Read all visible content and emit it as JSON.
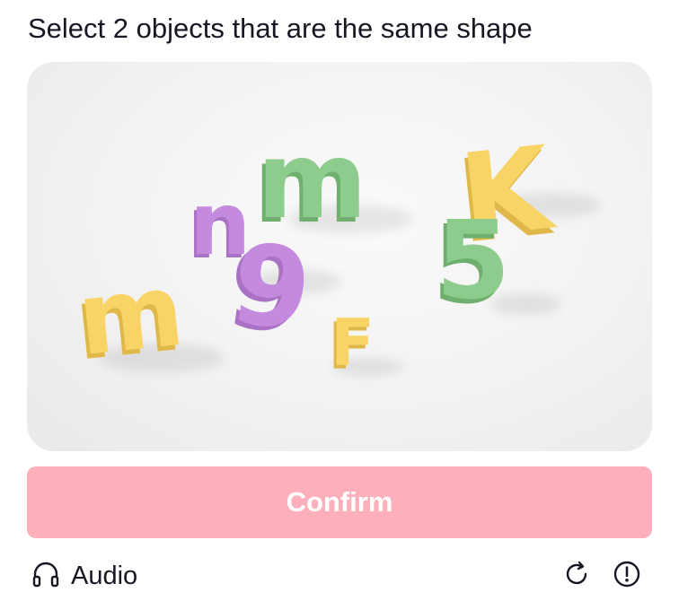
{
  "prompt": "Select 2 objects that are the same shape",
  "puzzle": {
    "objects": [
      {
        "id": "m-green",
        "glyph": "m",
        "color": "#8dcc8c"
      },
      {
        "id": "k-yellow",
        "glyph": "K",
        "color": "#f8d466"
      },
      {
        "id": "n-purple",
        "glyph": "n",
        "color": "#c38ade"
      },
      {
        "id": "nine-purple",
        "glyph": "9",
        "color": "#c38ade"
      },
      {
        "id": "five-green",
        "glyph": "5",
        "color": "#8dcc8c"
      },
      {
        "id": "m-yellow",
        "glyph": "m",
        "color": "#f8d466"
      },
      {
        "id": "f-yellow",
        "glyph": "F",
        "color": "#f8d466"
      }
    ]
  },
  "confirm_label": "Confirm",
  "audio_label": "Audio",
  "icons": {
    "audio": "headphones-icon",
    "refresh": "refresh-icon",
    "report": "report-icon"
  },
  "colors": {
    "accent": "#fdb0bb",
    "text": "#161823"
  }
}
